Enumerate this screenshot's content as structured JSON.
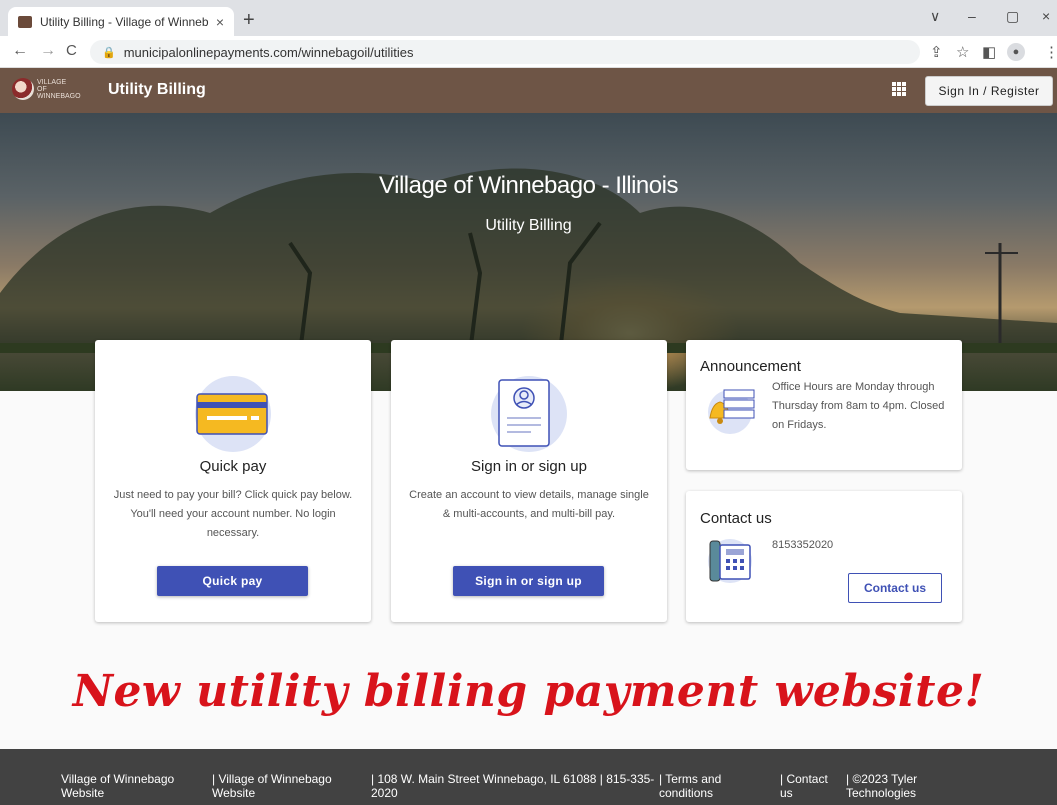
{
  "browser": {
    "tab_title": "Utility Billing - Village of Winneb",
    "tab_close": "×",
    "new_tab": "+",
    "url": "municipalonlinepayments.com/winnebagoil/utilities",
    "window_controls": [
      "∨",
      "–",
      "▢",
      "×"
    ]
  },
  "header": {
    "logo_text": "Village of WINNEBAGO",
    "app_title": "Utility Billing",
    "signin_label": "Sign In / Register"
  },
  "hero": {
    "title": "Village of Winnebago - Illinois",
    "subtitle": "Utility Billing"
  },
  "quick_pay": {
    "title": "Quick pay",
    "description": "Just need to pay your bill? Click quick pay below. You'll need your account number. No login necessary.",
    "button": "Quick pay"
  },
  "sign_in": {
    "title": "Sign in or sign up",
    "description": "Create an account to view details, manage single & multi-accounts, and multi-bill pay.",
    "button": "Sign in or sign up"
  },
  "announcement": {
    "title": "Announcement",
    "text": "Office Hours are Monday through Thursday from 8am to 4pm. Closed on Fridays."
  },
  "contact": {
    "title": "Contact us",
    "phone": "8153352020",
    "button": "Contact us"
  },
  "promo_text": "New utility billing payment website!",
  "footer": [
    "Village of Winnebago Website",
    "| Village of Winnebago Website",
    "| 108 W. Main Street Winnebago, IL 61088 | 815-335-2020",
    "| Terms and conditions",
    "| Contact us",
    "| ©2023 Tyler Technologies"
  ],
  "colors": {
    "app_bar": "#6e5546",
    "primary": "#3f51b5",
    "promo": "#d8131b",
    "footer": "#424242"
  },
  "icons": [
    "lock-icon",
    "share-icon",
    "star-icon",
    "sidebar-icon",
    "profile-icon",
    "menu-dots-icon",
    "apps-grid-icon",
    "credit-card-icon",
    "id-card-icon",
    "bell-icon",
    "phone-icon"
  ]
}
